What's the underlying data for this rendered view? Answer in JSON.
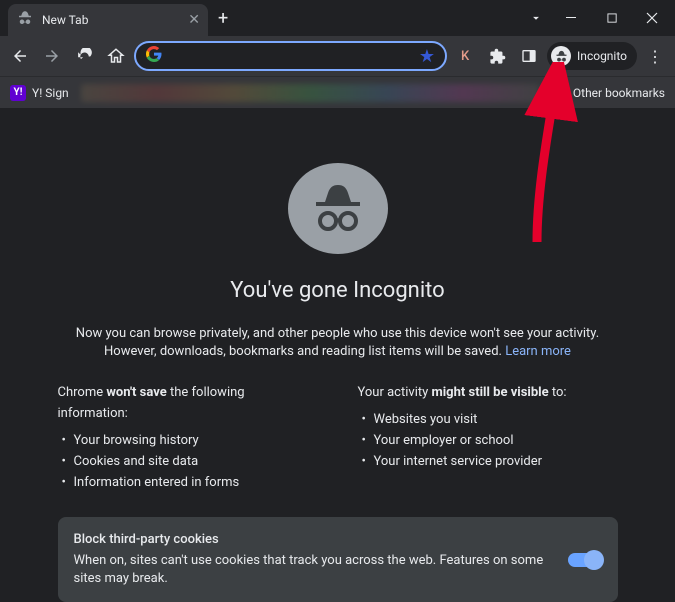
{
  "window": {
    "tab_title": "New Tab"
  },
  "omnibox": {
    "placeholder": ""
  },
  "toolbar": {
    "avatar_letter": "K",
    "incognito_label": "Incognito"
  },
  "bookmarks": {
    "first_label": "Y! Sign",
    "other_label": "Other bookmarks"
  },
  "page": {
    "heading": "You've gone Incognito",
    "paragraph": "Now you can browse privately, and other people who use this device won't see your activity. However, downloads, bookmarks and reading list items will be saved.",
    "learn_more": "Learn more",
    "col1_title_pre": "Chrome ",
    "col1_title_strong": "won't save",
    "col1_title_post": " the following information:",
    "col1_items": [
      "Your browsing history",
      "Cookies and site data",
      "Information entered in forms"
    ],
    "col2_title_pre": "Your activity ",
    "col2_title_strong": "might still be visible",
    "col2_title_post": " to:",
    "col2_items": [
      "Websites you visit",
      "Your employer or school",
      "Your internet service provider"
    ],
    "cookie_title": "Block third-party cookies",
    "cookie_body": "When on, sites can't use cookies that track you across the web. Features on some sites may break."
  }
}
